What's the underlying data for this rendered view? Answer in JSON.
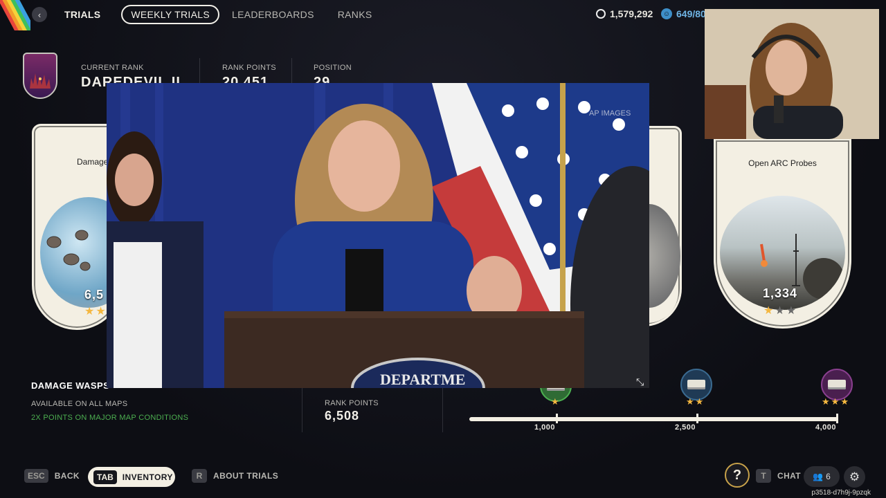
{
  "nav": {
    "back_icon": "chevron-left-icon",
    "section": "TRIALS",
    "tabs": [
      {
        "label": "WEEKLY TRIALS",
        "active": true
      },
      {
        "label": "LEADERBOARDS",
        "active": false
      },
      {
        "label": "RANKS",
        "active": false
      }
    ]
  },
  "currency": {
    "coins": "1,579,292",
    "tokens": "649/80"
  },
  "rank": {
    "current_rank_label": "CURRENT RANK",
    "current_rank_value": "DAREDEVIL II",
    "rank_points_label": "RANK POINTS",
    "rank_points_value": "20,451",
    "position_label": "POSITION",
    "position_value": "29"
  },
  "cards": [
    {
      "title": "Damage",
      "points": "6,5",
      "stars": 2
    },
    {
      "title": "Open ARC Probes",
      "points": "1,334",
      "stars": 1
    }
  ],
  "trial": {
    "name": "DAMAGE WASPS",
    "availability": "AVAILABLE ON ALL MAPS",
    "bonus": "2X POINTS ON MAJOR MAP CONDITIONS"
  },
  "personal": {
    "rank_points_label": "RANK POINTS",
    "rank_points_value": "6,508"
  },
  "progress": {
    "milestones": [
      {
        "label": "1,000",
        "stars": 1
      },
      {
        "label": "2,500",
        "stars": 2
      },
      {
        "label": "4,000",
        "stars": 3
      }
    ]
  },
  "footer": {
    "back_key": "ESC",
    "back_label": "BACK",
    "inventory_key": "TAB",
    "inventory_label": "INVENTORY",
    "about_key": "R",
    "about_label": "ABOUT TRIALS",
    "chat_key": "T",
    "chat_label": "CHAT",
    "party_count": "6",
    "help_symbol": "?"
  },
  "video": {
    "watermark": "AP IMAGES"
  },
  "session_id": "p3518-d7h9j-9pzqk",
  "colors": {
    "background": "#0d0e14",
    "card": "#f3efe3",
    "accent_green": "#4caf50",
    "star": "#f4b740"
  }
}
